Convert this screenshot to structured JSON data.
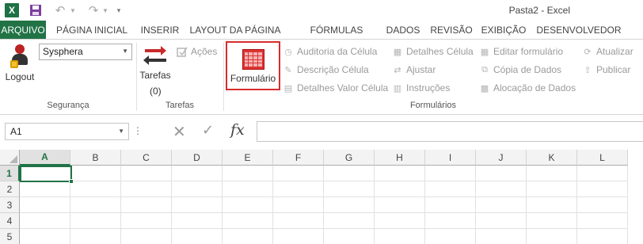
{
  "window": {
    "title": "Pasta2 - Excel"
  },
  "qat": {
    "app_icon": "X",
    "save_icon": "save-icon",
    "undo_icon": "undo-icon",
    "redo_icon": "redo-icon",
    "customize_icon": "chevron-down-icon"
  },
  "tabs": [
    {
      "label": "ARQUIVO",
      "key": "file"
    },
    {
      "label": "PÁGINA INICIAL",
      "key": "home"
    },
    {
      "label": "INSERIR",
      "key": "insert"
    },
    {
      "label": "LAYOUT DA PÁGINA",
      "key": "layout"
    },
    {
      "label": "FÓRMULAS",
      "key": "formulas"
    },
    {
      "label": "DADOS",
      "key": "data"
    },
    {
      "label": "REVISÃO",
      "key": "review"
    },
    {
      "label": "EXIBIÇÃO",
      "key": "view"
    },
    {
      "label": "DESENVOLVEDOR",
      "key": "developer"
    }
  ],
  "ribbon": {
    "security": {
      "group_label": "Segurança",
      "logout_label": "Logout",
      "profile_value": "Sysphera"
    },
    "tasks": {
      "group_label": "Tarefas",
      "button_label": "Tarefas",
      "count": "(0)",
      "actions_label": "Ações"
    },
    "forms": {
      "group_label": "Formulários",
      "form_button_label": "Formulário",
      "items": [
        {
          "label": "Auditoria da Célula",
          "icon": "audit-icon"
        },
        {
          "label": "Descrição Célula",
          "icon": "description-icon"
        },
        {
          "label": "Detalhes Valor Célula",
          "icon": "value-details-icon"
        },
        {
          "label": "Detalhes Célula",
          "icon": "cell-details-icon"
        },
        {
          "label": "Ajustar",
          "icon": "adjust-icon"
        },
        {
          "label": "Instruções",
          "icon": "instructions-icon"
        },
        {
          "label": "Editar formulário",
          "icon": "edit-form-icon"
        },
        {
          "label": "Cópia de Dados",
          "icon": "copy-data-icon"
        },
        {
          "label": "Alocação de Dados",
          "icon": "allocation-icon"
        },
        {
          "label": "Atualizar",
          "icon": "refresh-icon"
        },
        {
          "label": "Publicar",
          "icon": "publish-icon"
        }
      ]
    }
  },
  "formula_bar": {
    "name_box": "A1",
    "dots": "⋮",
    "cancel_icon": "✕",
    "enter_icon": "✓",
    "fx_label": "fx",
    "formula_value": ""
  },
  "sheet": {
    "columns": [
      "A",
      "B",
      "C",
      "D",
      "E",
      "F",
      "G",
      "H",
      "I",
      "J",
      "K",
      "L"
    ],
    "rows": [
      "1",
      "2",
      "3",
      "4",
      "5"
    ],
    "active_cell": "A1"
  },
  "colors": {
    "accent": "#217346",
    "highlight_border": "#d82c2c"
  }
}
